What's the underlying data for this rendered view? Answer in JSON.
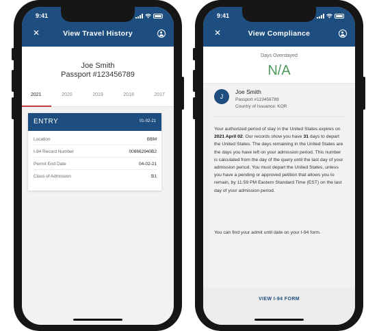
{
  "status_bar": {
    "time": "9:41"
  },
  "left_screen": {
    "title": "View Travel History",
    "name": "Joe Smith",
    "passport": "Passport #123456789",
    "years": [
      "2021",
      "2020",
      "2019",
      "2018",
      "2017"
    ],
    "active_year": "2021",
    "entry_card": {
      "heading": "ENTRY",
      "date": "01-02-21",
      "rows": [
        {
          "label": "Location",
          "value": "BBM"
        },
        {
          "label": "I-94 Record Number",
          "value": "008662940B2"
        },
        {
          "label": "Permit End Date",
          "value": "04-02-21"
        },
        {
          "label": "Class of Admission",
          "value": "B1"
        }
      ]
    }
  },
  "right_screen": {
    "title": "View Compliance",
    "days_overstayed_label": "Days Overstayed",
    "days_overstayed_value": "N/A",
    "avatar_initial": "J",
    "name": "Joe Smith",
    "passport": "Passport #123456789",
    "country": "Country of Issuance: KOR",
    "para1_a": "Your authorized period of stay in the United States expires on ",
    "para1_date": "2021 April 02",
    "para1_b": ". Our records show you have ",
    "para1_days": "31",
    "para1_c": " days to depart the United States. The days remaining in the United States are the days you have left on your admission period. This number is calculated from the day of the query until the last day of your admission period. You must depart the United States, unless you have a pending or approved petition that allows you to remain, by 11:59 PM Eastern Standard Time (EST) on the last day of your admission period.",
    "para2": "You can find your admit until date on your I-94 form.",
    "view_form_label": "VIEW I-94 FORM"
  }
}
